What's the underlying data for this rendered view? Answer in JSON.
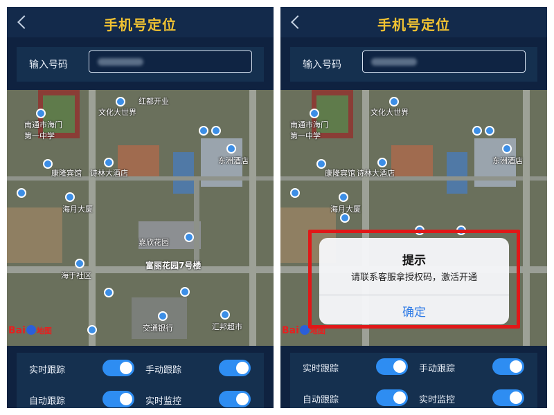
{
  "screens": [
    {
      "nav": {
        "title": "手机号定位"
      },
      "input": {
        "label": "输入号码"
      },
      "map": {
        "labels": {
          "school": "南通市海门\n第一中学",
          "wenhua": "文化大世界",
          "shilin": "诗林大酒店",
          "hongdu": "红都开业",
          "kanglong": "康隆宾馆",
          "hengyue": "海月大厦",
          "jiaxin": "嘉欣花园",
          "garden7": "富丽花园7号楼",
          "dongzhou": "东洲酒店",
          "haiyu": "海于社区",
          "bank": "交通银行",
          "shop": "汇邦超市"
        },
        "logo": {
          "bai": "Bai",
          "du": "地图"
        }
      },
      "controls": [
        {
          "label": "实时跟踪",
          "on": true
        },
        {
          "label": "手动跟踪",
          "on": true
        },
        {
          "label": "自动跟踪",
          "on": true
        },
        {
          "label": "实时监控",
          "on": true
        }
      ]
    },
    {
      "nav": {
        "title": "手机号定位"
      },
      "input": {
        "label": "输入号码"
      },
      "map": {
        "labels": {
          "school": "南通市海门\n第一中学",
          "wenhua": "文化大世界",
          "shilin": "诗林大酒店",
          "kanglong": "康隆宾馆",
          "hengyue": "海月大厦",
          "dongzhou": "东洲酒店"
        },
        "logo": {
          "bai": "Bai",
          "du": "地图"
        }
      },
      "dialog": {
        "title": "提示",
        "message": "请联系客服拿授权码，激活开通",
        "confirm": "确定"
      },
      "controls": [
        {
          "label": "实时跟踪",
          "on": true
        },
        {
          "label": "手动跟踪",
          "on": true
        },
        {
          "label": "自动跟踪",
          "on": true
        },
        {
          "label": "实时监控",
          "on": true
        }
      ]
    }
  ],
  "colors": {
    "accent": "#f1c232",
    "toggle": "#2e8df2",
    "highlight": "#e01818",
    "link": "#2f7be6"
  }
}
